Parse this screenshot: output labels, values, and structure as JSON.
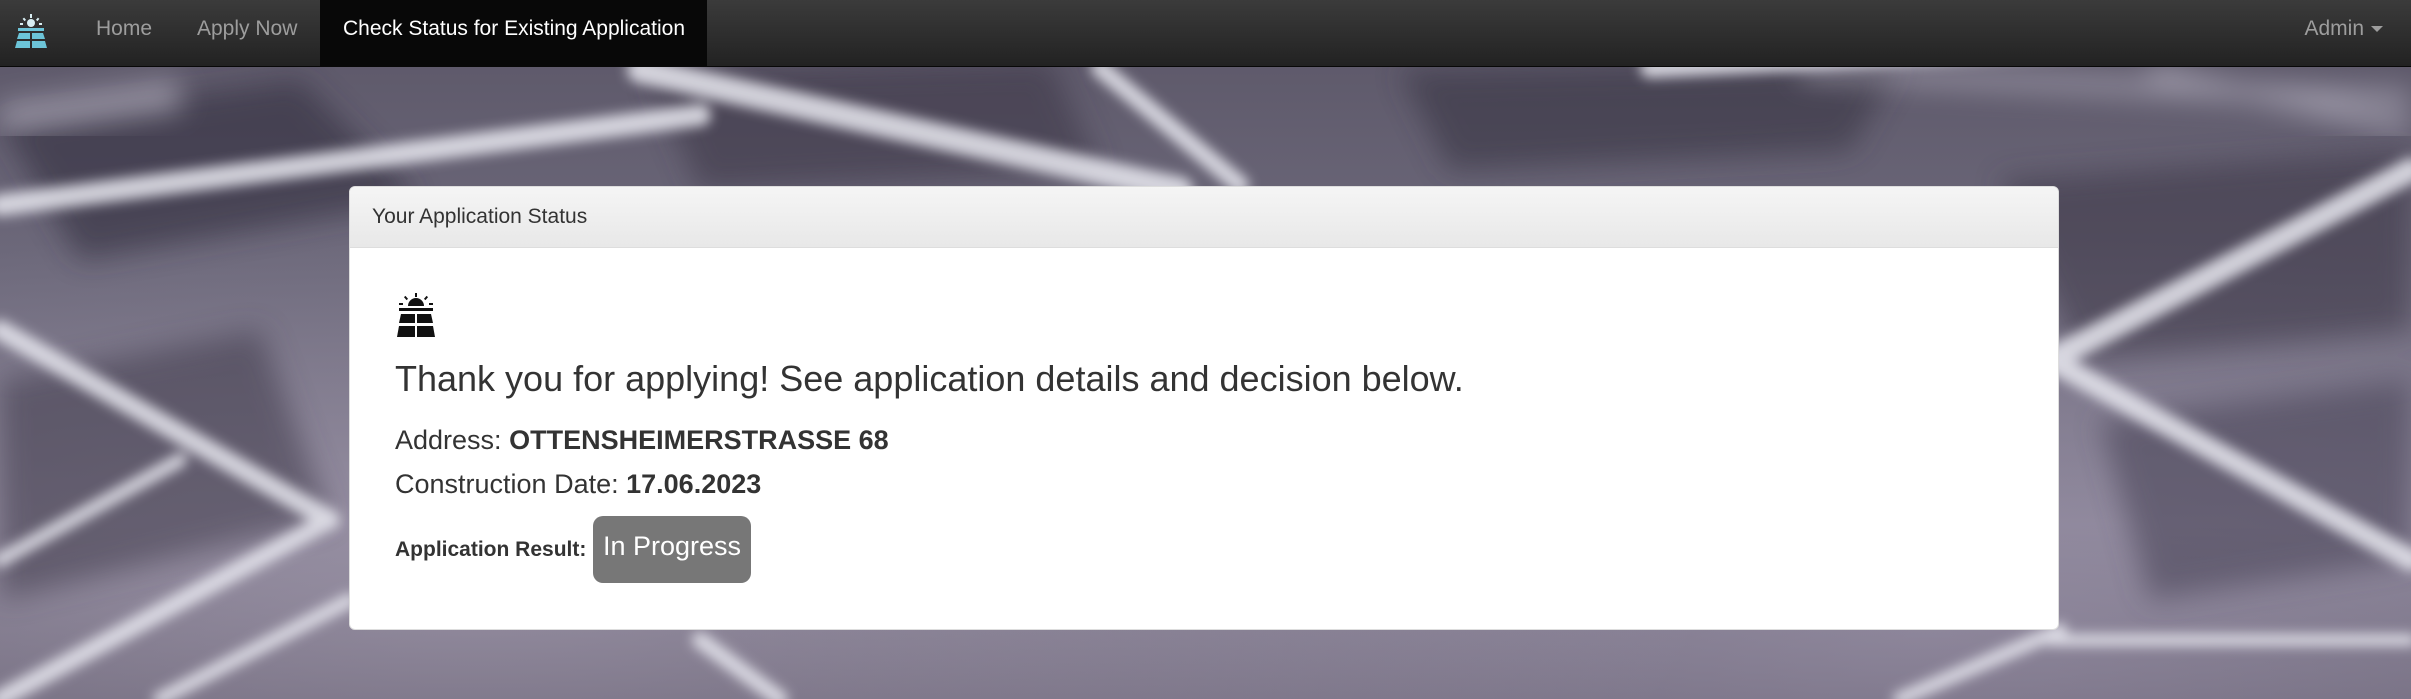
{
  "navbar": {
    "brand_icon": "solar-panel-sun-icon",
    "items": [
      {
        "label": "Home"
      },
      {
        "label": "Apply Now"
      },
      {
        "label": "Check Status for Existing Application",
        "active": true
      }
    ],
    "user_menu_label": "Admin"
  },
  "panel": {
    "heading": "Your Application Status",
    "icon": "solar-panel-sun-icon",
    "thanks_message": "Thank you for applying! See application details and decision below.",
    "address_label": "Address:",
    "address_value": "OTTENSHEIMERSTRASSE 68",
    "construction_date_label": "Construction Date:",
    "construction_date_value": "17.06.2023",
    "result_label": "Application Result:",
    "result_value": "In Progress"
  },
  "colors": {
    "navbar_bg": "#222222",
    "nav_active_bg": "#080808",
    "badge_bg": "#777777"
  }
}
